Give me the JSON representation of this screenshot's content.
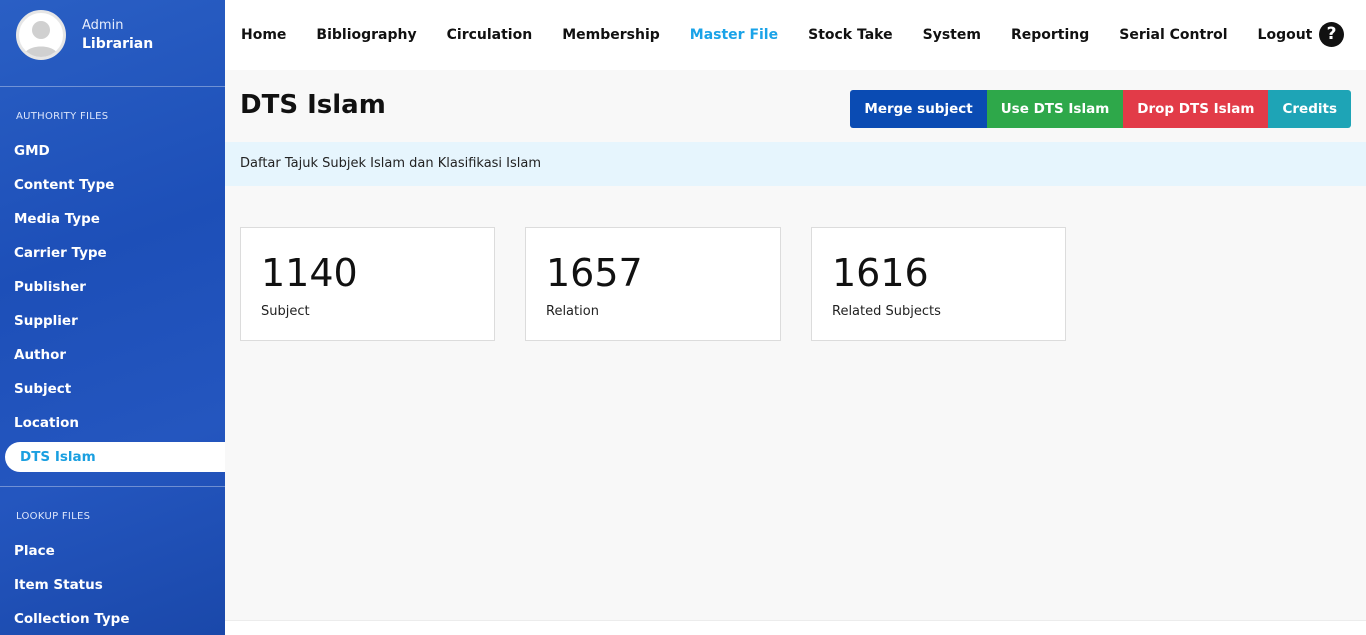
{
  "user": {
    "name": "Admin",
    "role": "Librarian"
  },
  "sidebar": {
    "authority_title": "AUTHORITY FILES",
    "authority_items": [
      "GMD",
      "Content Type",
      "Media Type",
      "Carrier Type",
      "Publisher",
      "Supplier",
      "Author",
      "Subject",
      "Location",
      "DTS Islam"
    ],
    "active_item": "DTS Islam",
    "lookup_title": "LOOKUP FILES",
    "lookup_items": [
      "Place",
      "Item Status",
      "Collection Type"
    ]
  },
  "nav": {
    "items": [
      "Home",
      "Bibliography",
      "Circulation",
      "Membership",
      "Master File",
      "Stock Take",
      "System",
      "Reporting",
      "Serial Control",
      "Logout"
    ],
    "active": "Master File"
  },
  "page": {
    "title": "DTS Islam",
    "description": "Daftar Tajuk Subjek Islam dan Klasifikasi Islam"
  },
  "actions": {
    "merge": "Merge subject",
    "use": "Use DTS Islam",
    "drop": "Drop DTS Islam",
    "credits": "Credits"
  },
  "stats": [
    {
      "value": "1140",
      "label": "Subject"
    },
    {
      "value": "1657",
      "label": "Relation"
    },
    {
      "value": "1616",
      "label": "Related Subjects"
    }
  ],
  "colors": {
    "sidebar": "#1d4fb8",
    "active_link": "#1aa3e8",
    "merge": "#0a4bb3",
    "use": "#2ea84a",
    "drop": "#e23b48",
    "credits": "#1ea4b6",
    "info_bar": "#e6f5fd"
  }
}
